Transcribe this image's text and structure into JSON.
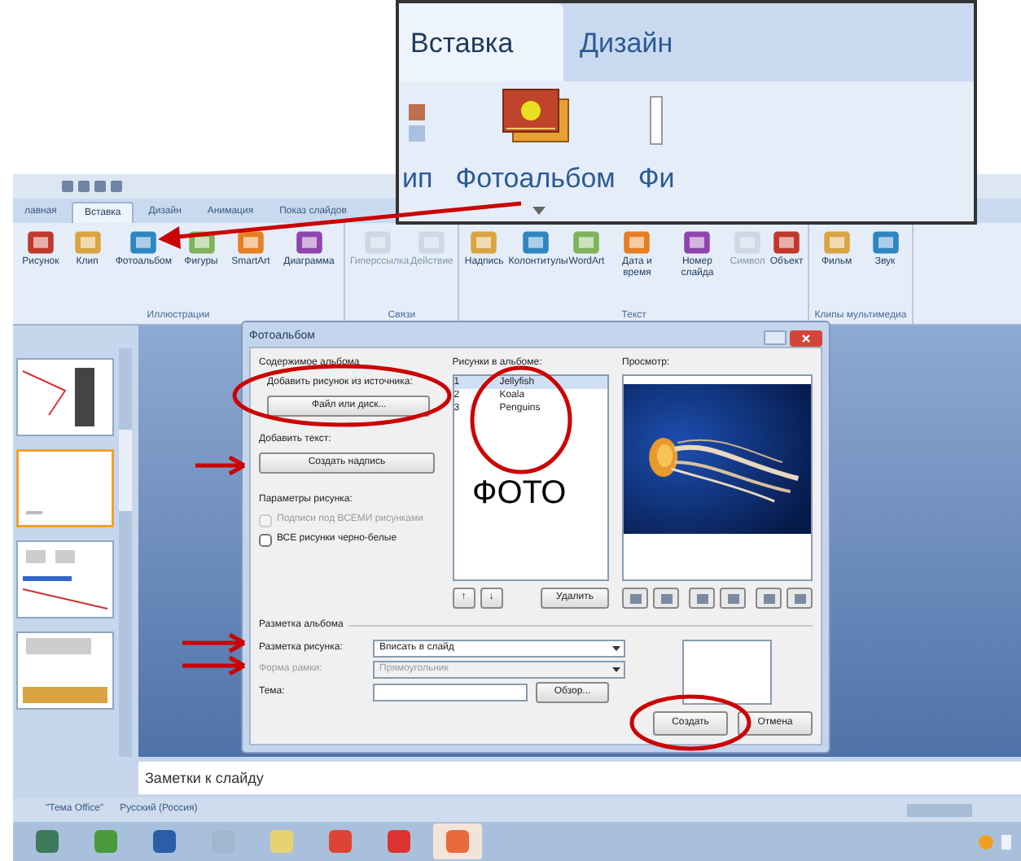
{
  "inset": {
    "tabs": [
      {
        "label": "Вставка",
        "selected": true
      },
      {
        "label": "Дизайн",
        "selected": false
      }
    ],
    "buttons": [
      {
        "label": "ип",
        "kind": "clip"
      },
      {
        "label": "Фотоальбом",
        "kind": "album"
      },
      {
        "label": "Фи",
        "kind": "cut"
      }
    ]
  },
  "ribbon": {
    "tabs": [
      {
        "label": "лавная",
        "selected": false
      },
      {
        "label": "Вставка",
        "selected": true
      },
      {
        "label": "Дизайн",
        "selected": false
      },
      {
        "label": "Анимация",
        "selected": false
      },
      {
        "label": "Показ слайдов",
        "selected": false
      }
    ],
    "groups": [
      {
        "label": "Иллюстрации",
        "buttons": [
          {
            "label": "Рисунок",
            "disabled": false
          },
          {
            "label": "Клип",
            "disabled": false
          },
          {
            "label": "Фотоальбом",
            "disabled": false
          },
          {
            "label": "Фигуры",
            "disabled": false
          },
          {
            "label": "SmartArt",
            "disabled": false
          },
          {
            "label": "Диаграмма",
            "disabled": false
          }
        ]
      },
      {
        "label": "Связи",
        "buttons": [
          {
            "label": "Гиперссылка",
            "disabled": true
          },
          {
            "label": "Действие",
            "disabled": true
          }
        ]
      },
      {
        "label": "Текст",
        "buttons": [
          {
            "label": "Надпись",
            "disabled": false
          },
          {
            "label": "Колонтитулы",
            "disabled": false
          },
          {
            "label": "WordArt",
            "disabled": false
          },
          {
            "label": "Дата и время",
            "disabled": false
          },
          {
            "label": "Номер слайда",
            "disabled": false
          },
          {
            "label": "Символ",
            "disabled": true
          },
          {
            "label": "Объект",
            "disabled": false
          }
        ]
      },
      {
        "label": "Клипы мультимедиа",
        "buttons": [
          {
            "label": "Фильм",
            "disabled": false
          },
          {
            "label": "Звук",
            "disabled": false
          }
        ]
      }
    ]
  },
  "slides_panel": {
    "thumbnails": [
      {
        "selected": false
      },
      {
        "selected": true
      },
      {
        "selected": false
      },
      {
        "selected": false
      }
    ]
  },
  "dialog": {
    "title": "Фотоальбом",
    "content_heading": "Содержимое альбома",
    "source_label": "Добавить рисунок из источника:",
    "file_button": "Файл или диск...",
    "text_label": "Добавить текст:",
    "caption_button": "Создать надпись",
    "options_label": "Параметры рисунка:",
    "checkboxes": [
      {
        "label": "Подписи под ВСЕМИ рисунками",
        "checked": false,
        "disabled": true
      },
      {
        "label": "ВСЕ рисунки черно-белые",
        "checked": false,
        "disabled": false
      }
    ],
    "list_label": "Рисунки в альбоме:",
    "pictures": [
      {
        "number": "1",
        "name": "Jellyfish",
        "selected": true
      },
      {
        "number": "2",
        "name": "Koala",
        "selected": false
      },
      {
        "number": "3",
        "name": "Penguins",
        "selected": false
      }
    ],
    "up_button": "↑",
    "down_button": "↓",
    "remove_button": "Удалить",
    "preview_label": "Просмотр:",
    "layout_heading": "Разметка альбома",
    "fields": [
      {
        "label": "Разметка рисунка:",
        "value": "Вписать в слайд",
        "kind": "dropdown",
        "disabled": false
      },
      {
        "label": "Форма рамки:",
        "value": "Прямоугольник",
        "kind": "dropdown",
        "disabled": true
      },
      {
        "label": "Тема:",
        "kind": "browse",
        "button": "Обзор...",
        "disabled": false
      }
    ],
    "create_button": "Создать",
    "cancel_button": "Отмена"
  },
  "annotation_text": "ФОТО",
  "notes": {
    "placeholder": "Заметки к слайду"
  },
  "status_bar": {
    "theme": "\"Тема Office\"",
    "language": "Русский (Россия)"
  },
  "taskbar": {
    "items": [
      {
        "selected": false
      },
      {
        "selected": false
      },
      {
        "selected": false
      },
      {
        "selected": false
      },
      {
        "selected": false
      },
      {
        "selected": false
      },
      {
        "selected": false
      },
      {
        "selected": true
      }
    ]
  }
}
